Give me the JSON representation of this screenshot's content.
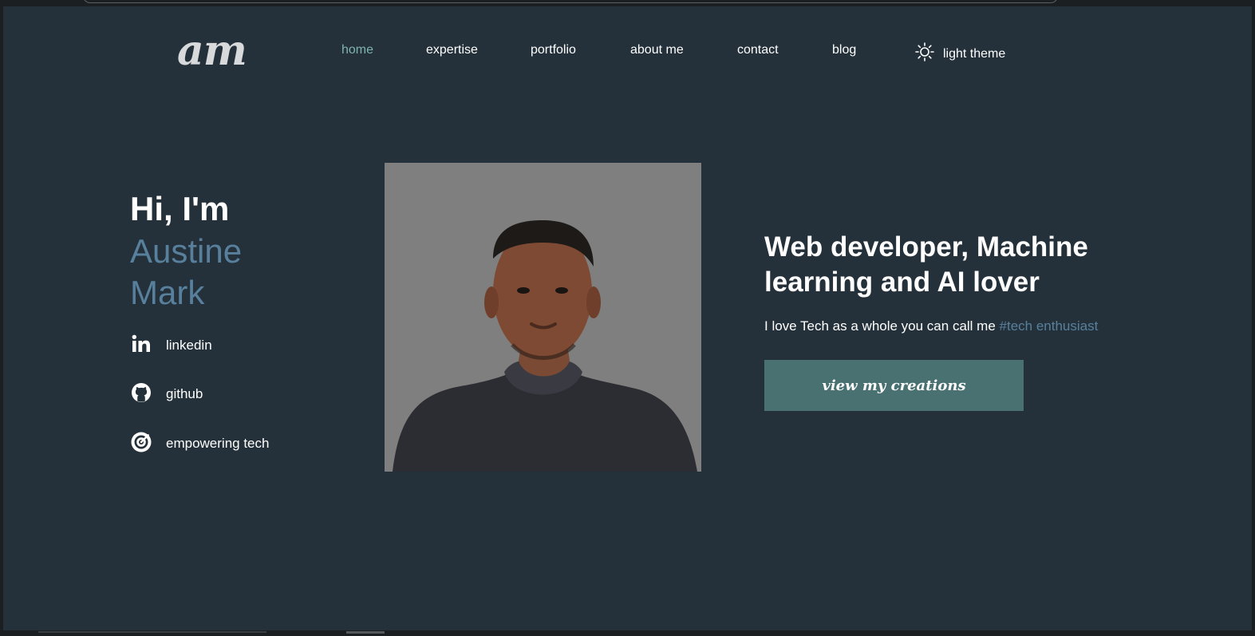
{
  "header": {
    "logo_text": "am",
    "nav": [
      {
        "label": "home",
        "active": true
      },
      {
        "label": "expertise",
        "active": false
      },
      {
        "label": "portfolio",
        "active": false
      },
      {
        "label": "about me",
        "active": false
      },
      {
        "label": "contact",
        "active": false
      },
      {
        "label": "blog",
        "active": false
      }
    ],
    "theme_toggle": {
      "label": "light theme",
      "icon": "sun-icon"
    }
  },
  "hero": {
    "greeting": "Hi, I'm",
    "first_name": "Austine",
    "last_name": "Mark",
    "socials": [
      {
        "label": "linkedin",
        "icon": "linkedin-icon"
      },
      {
        "label": "github",
        "icon": "github-icon"
      },
      {
        "label": "empowering tech",
        "icon": "target-icon"
      }
    ],
    "headline": "Web developer, Machine learning and AI lover",
    "tagline": "I love Tech as a whole you can call me ",
    "hashtag": "#tech enthusiast",
    "cta_label": "view my creations"
  },
  "colors": {
    "background": "#24313a",
    "accent": "#58809c",
    "nav_active": "#7fb3ad",
    "button": "#4a7172",
    "photo_bg": "#7f7f7f"
  }
}
